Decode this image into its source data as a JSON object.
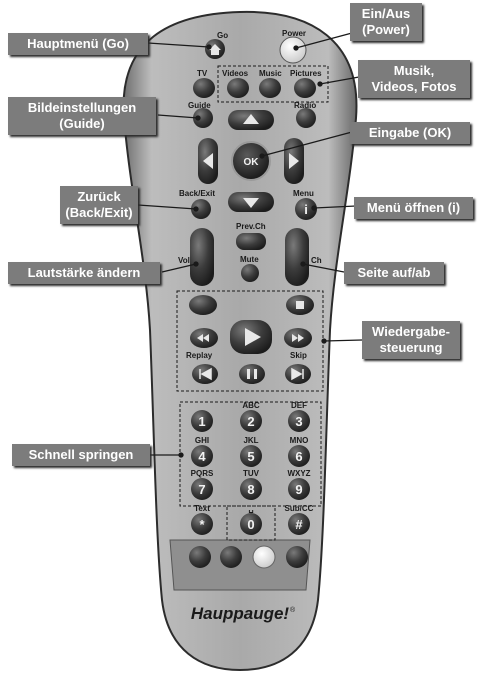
{
  "callouts": {
    "hauptmenu": "Hauptmenü (Go)",
    "power_1": "Ein/Aus",
    "power_2": "(Power)",
    "media_1": "Musik,",
    "media_2": "Videos, Fotos",
    "guide_1": "Bildeinstellungen",
    "guide_2": "(Guide)",
    "ok": "Eingabe (OK)",
    "back_1": "Zurück",
    "back_2": "(Back/Exit)",
    "menu": "Menü öffnen (i)",
    "volume": "Lautstärke ändern",
    "channel": "Seite auf/ab",
    "playback_1": "Wiedergabe-",
    "playback_2": "steuerung",
    "numbers": "Schnell springen"
  },
  "remote": {
    "go": "Go",
    "power": "Power",
    "tv": "TV",
    "videos": "Videos",
    "music": "Music",
    "pictures": "Pictures",
    "guide": "Guide",
    "radio": "Radio",
    "ok": "OK",
    "back_exit": "Back/Exit",
    "menu": "Menu",
    "menu_key": "i",
    "prev_ch": "Prev.Ch",
    "vol": "Vol",
    "mute": "Mute",
    "ch": "Ch",
    "replay": "Replay",
    "skip": "Skip",
    "keys": [
      {
        "num": "1",
        "letters": ""
      },
      {
        "num": "2",
        "letters": "ABC"
      },
      {
        "num": "3",
        "letters": "DEF"
      },
      {
        "num": "4",
        "letters": "GHI"
      },
      {
        "num": "5",
        "letters": "JKL"
      },
      {
        "num": "6",
        "letters": "MNO"
      },
      {
        "num": "7",
        "letters": "PQRS"
      },
      {
        "num": "8",
        "letters": "TUV"
      },
      {
        "num": "9",
        "letters": "WXYZ"
      },
      {
        "num": "*",
        "letters": "Text"
      },
      {
        "num": "0",
        "letters": "␣"
      },
      {
        "num": "#",
        "letters": "Sub/CC"
      }
    ],
    "brand": "Hauppauge!",
    "brand_mark": "®"
  }
}
